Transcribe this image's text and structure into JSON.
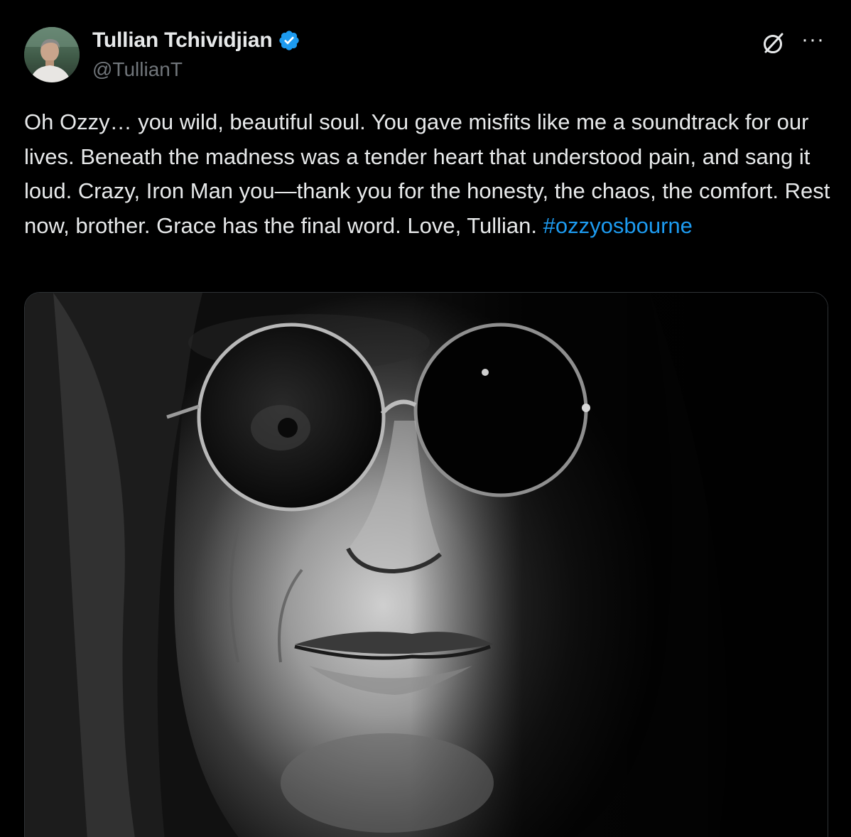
{
  "author": {
    "display_name": "Tullian Tchividjian",
    "handle": "@TullianT",
    "verified": true,
    "verified_color": "#1d9bf0"
  },
  "header_icons": {
    "grok": "grok-icon",
    "more": "more-options-icon",
    "more_glyph": "···"
  },
  "tweet": {
    "text": "Oh Ozzy… you wild, beautiful soul. You gave misfits like me a soundtrack for our lives. Beneath the madness was a tender heart that understood pain, and sang it loud. Crazy, Iron Man you—thank you for the honesty, the chaos, the comfort. Rest now, brother. Grace has the final word. Love, Tullian. ",
    "hashtag": "#ozzyosbourne",
    "hashtag_color": "#1d9bf0"
  },
  "media": {
    "type": "photo",
    "subject": "black-and-white close-up portrait with round dark sunglasses and long hair"
  },
  "colors": {
    "background": "#000000",
    "text": "#e7e9ea",
    "secondary": "#71767b"
  }
}
